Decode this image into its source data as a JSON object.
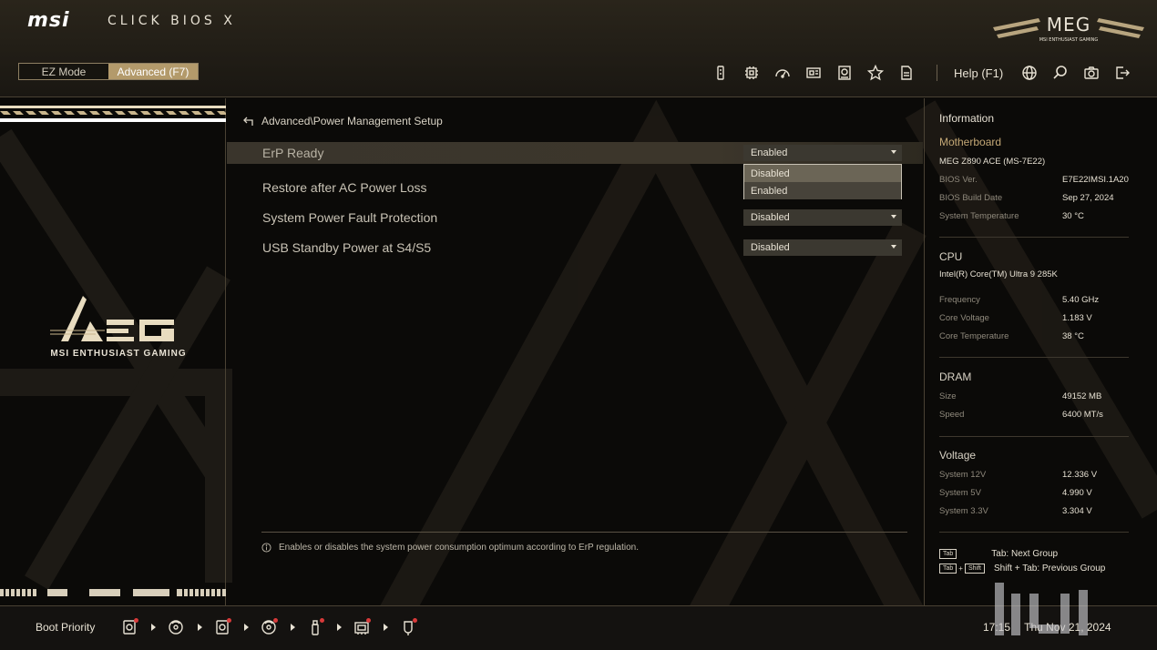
{
  "header": {
    "brand": "msi",
    "app_title": "CLICK BIOS X",
    "modes": [
      {
        "label": "EZ Mode",
        "active": false
      },
      {
        "label": "Advanced (F7)",
        "active": true
      }
    ],
    "help_label": "Help (F1)",
    "toolbar_icons": [
      "memory-icon",
      "cpu-icon",
      "gauge-icon",
      "board-icon",
      "storage-icon",
      "star-icon",
      "document-icon"
    ],
    "right_icons": [
      "globe-icon",
      "search-icon",
      "camera-icon",
      "exit-icon"
    ],
    "accent": "#b39a6b"
  },
  "left_panel": {
    "logo_text": "MSI ENTHUSIAST GAMING"
  },
  "main": {
    "breadcrumb": "Advanced\\Power Management Setup",
    "settings": [
      {
        "label": "ErP Ready",
        "value": "Enabled",
        "selected": true
      },
      {
        "label": "Restore after AC Power Loss",
        "value": "",
        "selected": false
      },
      {
        "label": "System Power Fault Protection",
        "value": "Disabled",
        "selected": false
      },
      {
        "label": "USB Standby Power at S4/S5",
        "value": "Disabled",
        "selected": false
      }
    ],
    "open_dropdown": {
      "options": [
        "Disabled",
        "Enabled"
      ]
    },
    "help_text": "Enables or disables the system power consumption optimum according to ErP regulation."
  },
  "info": {
    "title": "Information",
    "motherboard": {
      "heading": "Motherboard",
      "model": "MEG Z890 ACE (MS-7E22)",
      "rows": [
        {
          "key": "BIOS Ver.",
          "val": "E7E22IMSI.1A20"
        },
        {
          "key": "BIOS Build Date",
          "val": "Sep 27, 2024"
        },
        {
          "key": "System Temperature",
          "val": "30 °C"
        }
      ]
    },
    "cpu": {
      "heading": "CPU",
      "model": "Intel(R) Core(TM) Ultra 9 285K",
      "rows": [
        {
          "key": "Frequency",
          "val": "5.40 GHz"
        },
        {
          "key": "Core Voltage",
          "val": "1.183 V"
        },
        {
          "key": "Core Temperature",
          "val": "38 °C"
        }
      ]
    },
    "dram": {
      "heading": "DRAM",
      "rows": [
        {
          "key": "Size",
          "val": "49152 MB"
        },
        {
          "key": "Speed",
          "val": "6400 MT/s"
        }
      ]
    },
    "voltage": {
      "heading": "Voltage",
      "rows": [
        {
          "key": "System 12V",
          "val": "12.336 V"
        },
        {
          "key": "System 5V",
          "val": "4.990 V"
        },
        {
          "key": "System 3.3V",
          "val": "3.304 V"
        }
      ]
    },
    "keys": [
      {
        "caps": [
          "Tab"
        ],
        "text": "Tab: Next Group"
      },
      {
        "caps": [
          "Tab",
          "Shift"
        ],
        "text": "Shift + Tab: Previous Group"
      }
    ]
  },
  "footer": {
    "boot_label": "Boot Priority",
    "boot_devices": [
      "usb-disk-icon",
      "optical-disc-icon",
      "usb-disk-icon",
      "optical-disc-icon",
      "usb-stick-icon",
      "network-card-icon",
      "uefi-shell-icon"
    ],
    "time": "17:15",
    "date": "Thu Nov 21, 2024"
  }
}
